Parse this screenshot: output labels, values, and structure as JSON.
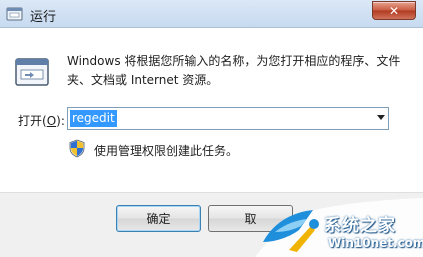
{
  "window": {
    "title": "运行",
    "close_glyph": "✕"
  },
  "dialog": {
    "description": "Windows 将根据您所输入的名称，为您打开相应的程序、文件夹、文档或 Internet 资源。",
    "open_label_prefix": "打开(",
    "open_label_key": "O",
    "open_label_suffix": "):",
    "command_value": "regedit",
    "admin_note": "使用管理权限创建此任务。"
  },
  "buttons": {
    "ok": "确定",
    "cancel": "取"
  },
  "watermark": {
    "title": "系统之家",
    "url": "Win10net.com"
  },
  "icons": {
    "title": "run-icon",
    "main": "run-icon",
    "shield": "uac-shield-icon",
    "dropdown": "chevron-down-icon",
    "close": "close-icon"
  },
  "colors": {
    "selection": "#3399ff",
    "close_button": "#c75a40",
    "titlebar": "#dbe8f6"
  }
}
